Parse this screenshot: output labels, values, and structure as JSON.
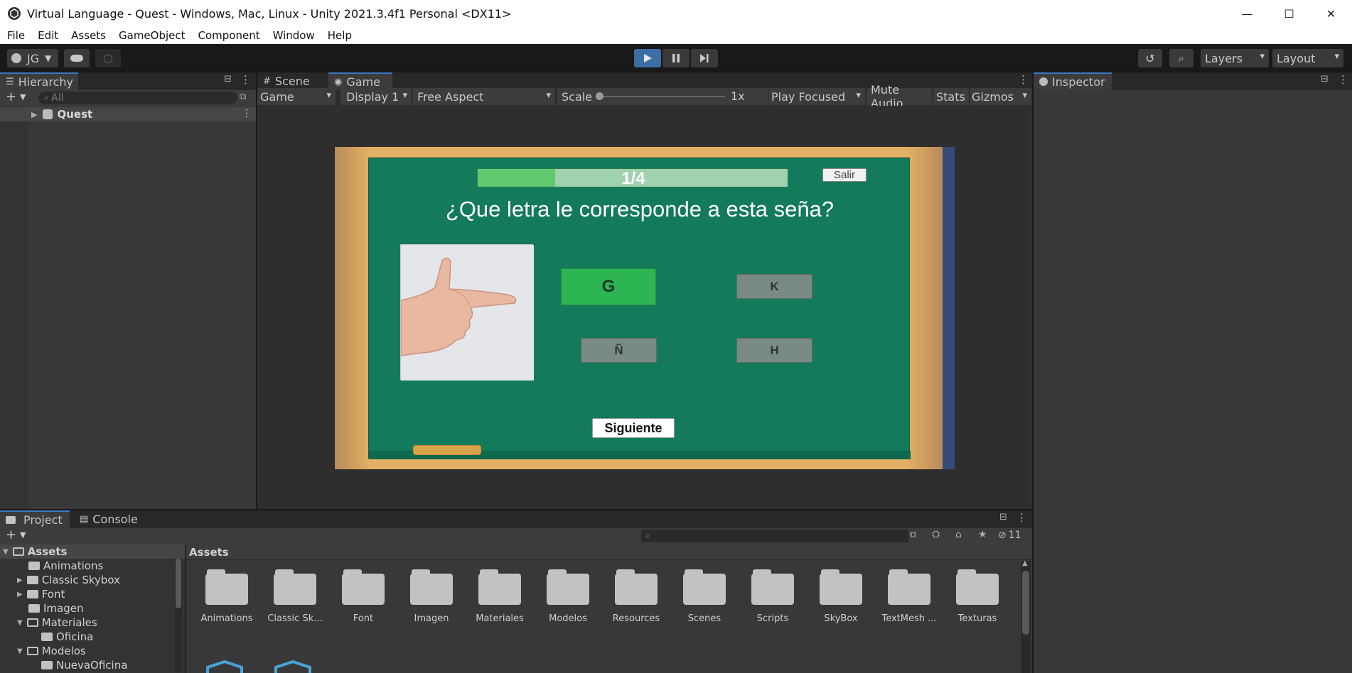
{
  "window": {
    "title": "Virtual Language - Quest - Windows, Mac, Linux - Unity 2021.3.4f1 Personal <DX11>",
    "minimize_glyph": "—",
    "maximize_glyph": "☐",
    "close_glyph": "✕"
  },
  "menu": [
    "File",
    "Edit",
    "Assets",
    "GameObject",
    "Component",
    "Window",
    "Help"
  ],
  "toolbar": {
    "account_label": "JG",
    "layers_label": "Layers",
    "layout_label": "Layout"
  },
  "hierarchy": {
    "tab_label": "Hierarchy",
    "search_placeholder": "All",
    "root_item": "Quest"
  },
  "scene_tabs": {
    "scene_label": "Scene",
    "game_label": "Game"
  },
  "game_controls": {
    "mode": "Game",
    "display": "Display 1",
    "aspect": "Free Aspect",
    "scale_label": "Scale",
    "scale_value": "1x",
    "play_focused": "Play Focused",
    "mute_audio": "Mute Audio",
    "stats": "Stats",
    "gizmos": "Gizmos"
  },
  "inspector": {
    "tab_label": "Inspector"
  },
  "quiz": {
    "progress_text": "1/4",
    "progress_fraction": 0.25,
    "exit_label": "Salir",
    "question": "¿Que letra le corresponde a esta seña?",
    "answers": [
      "G",
      "K",
      "Ñ",
      "H"
    ],
    "next_label": "Siguiente",
    "colors": {
      "board": "#137a5c",
      "frame": "#e1ae63",
      "correct": "#2db453",
      "option": "#7a8a84",
      "progress_fill": "#5ec96e",
      "progress_track": "#9fd2ad"
    }
  },
  "project": {
    "project_tab": "Project",
    "console_tab": "Console",
    "breadcrumb": "Assets",
    "hidden_count": "11",
    "tree": {
      "root": "Assets",
      "items": [
        "Animations",
        "Classic Skybox",
        "Font",
        "Imagen",
        "Materiales",
        "Oficina",
        "Modelos",
        "NuevaOficina"
      ]
    },
    "folders": [
      "Animations",
      "Classic Sk...",
      "Font",
      "Imagen",
      "Materiales",
      "Modelos",
      "Resources",
      "Scenes",
      "Scripts",
      "SkyBox",
      "TextMesh ...",
      "Texturas"
    ]
  }
}
